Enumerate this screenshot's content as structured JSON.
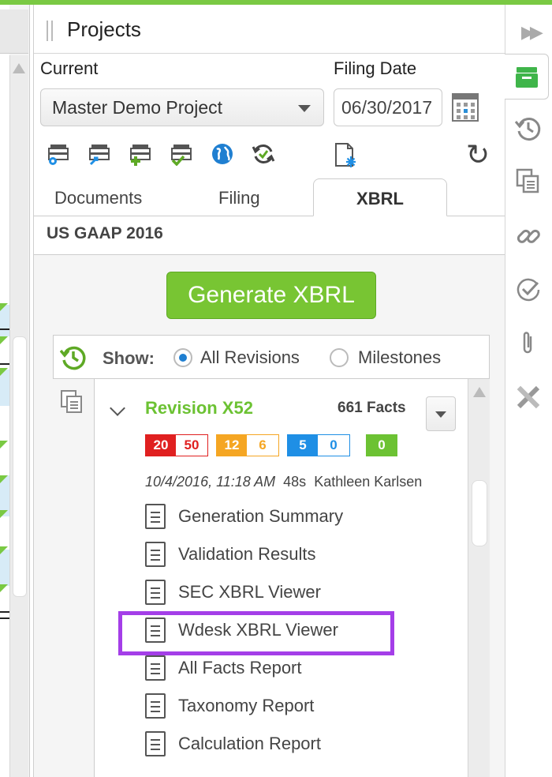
{
  "panel": {
    "title": "Projects"
  },
  "project": {
    "current_label": "Current",
    "filing_date_label": "Filing Date",
    "selected_project": "Master Demo Project",
    "filing_date": "06/30/2017"
  },
  "tabs": [
    {
      "label": "Documents"
    },
    {
      "label": "Filing"
    },
    {
      "label": "XBRL",
      "active": true
    }
  ],
  "xbrl": {
    "taxonomy": "US GAAP 2016",
    "generate_label": "Generate XBRL",
    "show_label": "Show:",
    "radio_all": "All Revisions",
    "radio_milestones": "Milestones",
    "revision": {
      "name": "Revision X52",
      "facts": "661 Facts",
      "counts": {
        "red_a": "20",
        "red_b": "50",
        "orange_a": "12",
        "orange_b": "6",
        "blue_a": "5",
        "blue_b": "0",
        "green": "0"
      },
      "timestamp": "10/4/2016, 11:18 AM",
      "duration": "48s",
      "author": "Kathleen Karlsen"
    },
    "reports": [
      "Generation Summary",
      "Validation Results",
      "SEC XBRL Viewer",
      "Wdesk XBRL Viewer",
      "All Facts Report",
      "Taxonomy Report",
      "Calculation Report"
    ]
  },
  "colors": {
    "accent_green": "#78c533",
    "highlight_purple": "#a43ee8",
    "error_red": "#e02020",
    "warning_orange": "#f5a623",
    "info_blue": "#1f8fe5"
  },
  "icons": {
    "toolbar": [
      "settings-drawer-icon",
      "share-drawer-icon",
      "add-drawer-icon",
      "check-drawer-icon",
      "globe-icon",
      "sync-icon",
      "freeze-document-icon",
      "refresh-icon"
    ],
    "sidebar": [
      "projects-icon",
      "history-icon",
      "copy-icon",
      "link-icon",
      "check-circle-icon",
      "attachment-icon",
      "xbrl-x-icon"
    ]
  }
}
